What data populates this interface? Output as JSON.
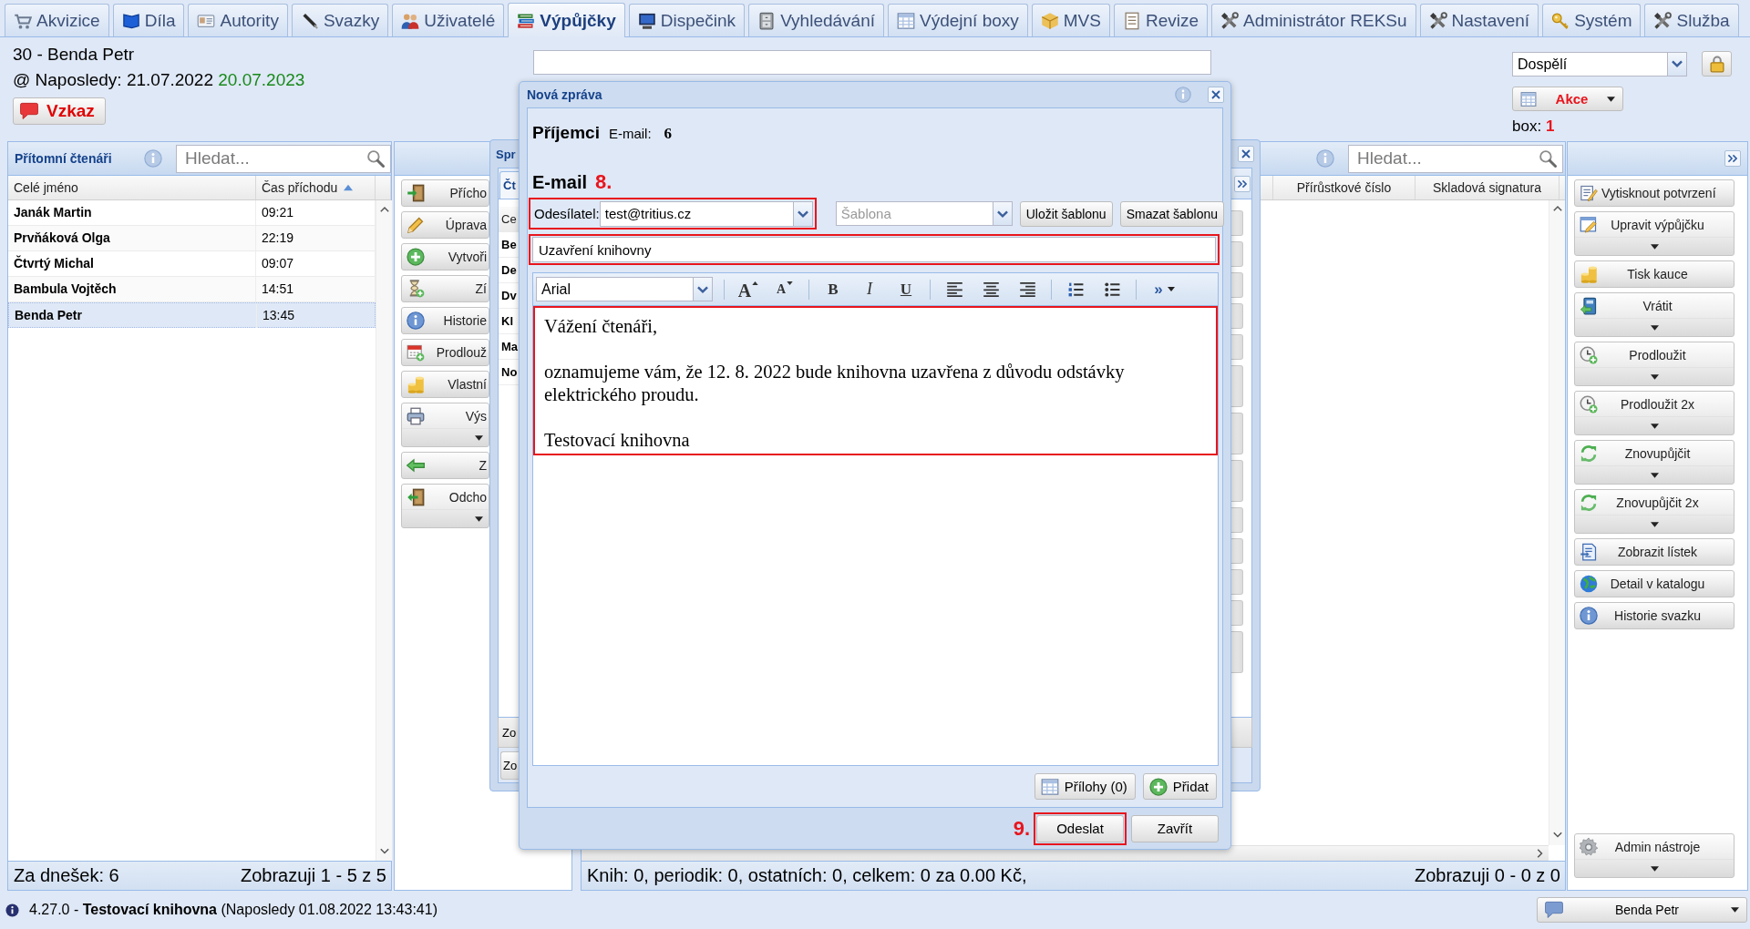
{
  "tabs": [
    {
      "label": "Akvizice",
      "selected": false
    },
    {
      "label": "Díla",
      "selected": false
    },
    {
      "label": "Autority",
      "selected": false
    },
    {
      "label": "Svazky",
      "selected": false
    },
    {
      "label": "Uživatelé",
      "selected": false
    },
    {
      "label": "Výpůjčky",
      "selected": true
    },
    {
      "label": "Dispečink",
      "selected": false
    },
    {
      "label": "Vyhledávání",
      "selected": false
    },
    {
      "label": "Výdejní boxy",
      "selected": false
    },
    {
      "label": "MVS",
      "selected": false
    },
    {
      "label": "Revize",
      "selected": false
    },
    {
      "label": "Administrátor REKSu",
      "selected": false
    },
    {
      "label": "Nastavení",
      "selected": false
    },
    {
      "label": "Systém",
      "selected": false
    },
    {
      "label": "Služba",
      "selected": false
    }
  ],
  "reader": {
    "heading": "30 - Benda Petr",
    "last_visit": "@ Naposledy: 21.07.2022",
    "valid_until": "20.07.2023",
    "message_button": "Vzkaz"
  },
  "category": {
    "value": "Dospělí"
  },
  "actions_button": "Akce",
  "box": {
    "label": "box:",
    "value": "1"
  },
  "present_readers": {
    "title": "Přítomní čtenáři",
    "search_placeholder": "Hledat...",
    "columns": [
      {
        "label": "Celé jméno",
        "sorted": false
      },
      {
        "label": "Čas příchodu",
        "sorted": true
      }
    ],
    "rows": [
      {
        "name": "Janák Martin",
        "time": "09:21",
        "selected": false
      },
      {
        "name": "Prvňáková Olga",
        "time": "22:19",
        "selected": false
      },
      {
        "name": "Čtvrtý Michal",
        "time": "09:07",
        "selected": false
      },
      {
        "name": "Bambula Vojtěch",
        "time": "14:51",
        "selected": false
      },
      {
        "name": "Benda Petr",
        "time": "13:45",
        "selected": true
      }
    ],
    "footer_left": "Za dnešek: 6",
    "footer_right": "Zobrazuji 1 - 5 z 5"
  },
  "reader_actions": [
    {
      "label": "Přícho",
      "dropdown": false
    },
    {
      "label": "Úprava",
      "dropdown": false
    },
    {
      "label": "Vytvoři",
      "dropdown": false
    },
    {
      "label": "Zí",
      "dropdown": false
    },
    {
      "label": "Historie",
      "dropdown": false
    },
    {
      "label": "Prodlouž",
      "dropdown": false
    },
    {
      "label": "Vlastní",
      "dropdown": false
    },
    {
      "label": "Výs",
      "dropdown": true
    },
    {
      "label": "Z",
      "dropdown": false
    },
    {
      "label": "Odcho",
      "dropdown": true
    }
  ],
  "loans_window": {
    "title": "Spr",
    "tab": "Čt",
    "header": "Ce",
    "rows": [
      "Be",
      "De",
      "Dv",
      "Kl",
      "Ma",
      "No"
    ],
    "footer": [
      "Zo",
      "Zo"
    ]
  },
  "loans": {
    "search_placeholder": "Hledat...",
    "columns": [
      "Přírůstkové číslo",
      "Skladová signatura"
    ],
    "summary": "Knih: 0, periodik: 0, ostatních: 0, celkem: 0 za 0.00 Kč,",
    "paging": "Zobrazuji 0 - 0 z 0"
  },
  "loan_actions": [
    {
      "label": "Vytisknout potvrzení",
      "dropdown": false
    },
    {
      "label": "Upravit výpůjčku",
      "dropdown": true
    },
    {
      "label": "Tisk kauce",
      "dropdown": false
    },
    {
      "label": "Vrátit",
      "dropdown": true
    },
    {
      "label": "Prodloužit",
      "dropdown": true
    },
    {
      "label": "Prodloužit 2x",
      "dropdown": true
    },
    {
      "label": "Znovupůjčit",
      "dropdown": true
    },
    {
      "label": "Znovupůjčit 2x",
      "dropdown": true
    },
    {
      "label": "Zobrazit lístek",
      "dropdown": false
    },
    {
      "label": "Detail v katalogu",
      "dropdown": false
    },
    {
      "label": "Historie svazku",
      "dropdown": false
    }
  ],
  "admin_button": {
    "label": "Admin nástroje",
    "dropdown": true
  },
  "status_bar": {
    "text": "4.27.0 - **Testovací knihovna** (Naposledy 01.08.2022 13:43:41)",
    "user_button": "Benda Petr"
  },
  "dialog": {
    "title": "Nová zpráva",
    "recipients_heading": "Příjemci",
    "recipients_label": "E-mail:",
    "recipients_count": "6",
    "email_heading": "E-mail",
    "email_step": "8.",
    "sender": {
      "label": "Odesílatel:",
      "value": "test@tritius.cz",
      "highlighted": true
    },
    "template": {
      "placeholder": "Šablona"
    },
    "template_buttons": [
      "Uložit šablonu",
      "Smazat šablonu"
    ],
    "subject": {
      "value": "Uzavření knihovny",
      "highlighted": true
    },
    "editor": {
      "font": "Arial",
      "toolbar": [
        {
          "kind": "grow",
          "glyph": "A"
        },
        {
          "kind": "shrink",
          "glyph": "A"
        },
        {
          "kind": "bold",
          "glyph": "B"
        },
        {
          "kind": "italic",
          "glyph": "I"
        },
        {
          "kind": "underline",
          "glyph": "U"
        },
        {
          "kind": "left"
        },
        {
          "kind": "center"
        },
        {
          "kind": "right"
        },
        {
          "kind": "numbered"
        },
        {
          "kind": "bulleted"
        },
        {
          "kind": "more",
          "glyph": "»"
        }
      ],
      "paragraphs": [
        "Vážení čtenáři,",
        "oznamujeme vám, že 12. 8. 2022 bude knihovna uzavřena z důvodu odstávky elektrického proudu.",
        "Testovací knihovna"
      ],
      "highlighted": true
    },
    "attachment_buttons": [
      "Přílohy (0)",
      "Přidat"
    ],
    "footer_step": "9.",
    "buttons": [
      {
        "label": "Odeslat",
        "highlighted": true
      },
      {
        "label": "Zavřít",
        "highlighted": false
      }
    ]
  }
}
